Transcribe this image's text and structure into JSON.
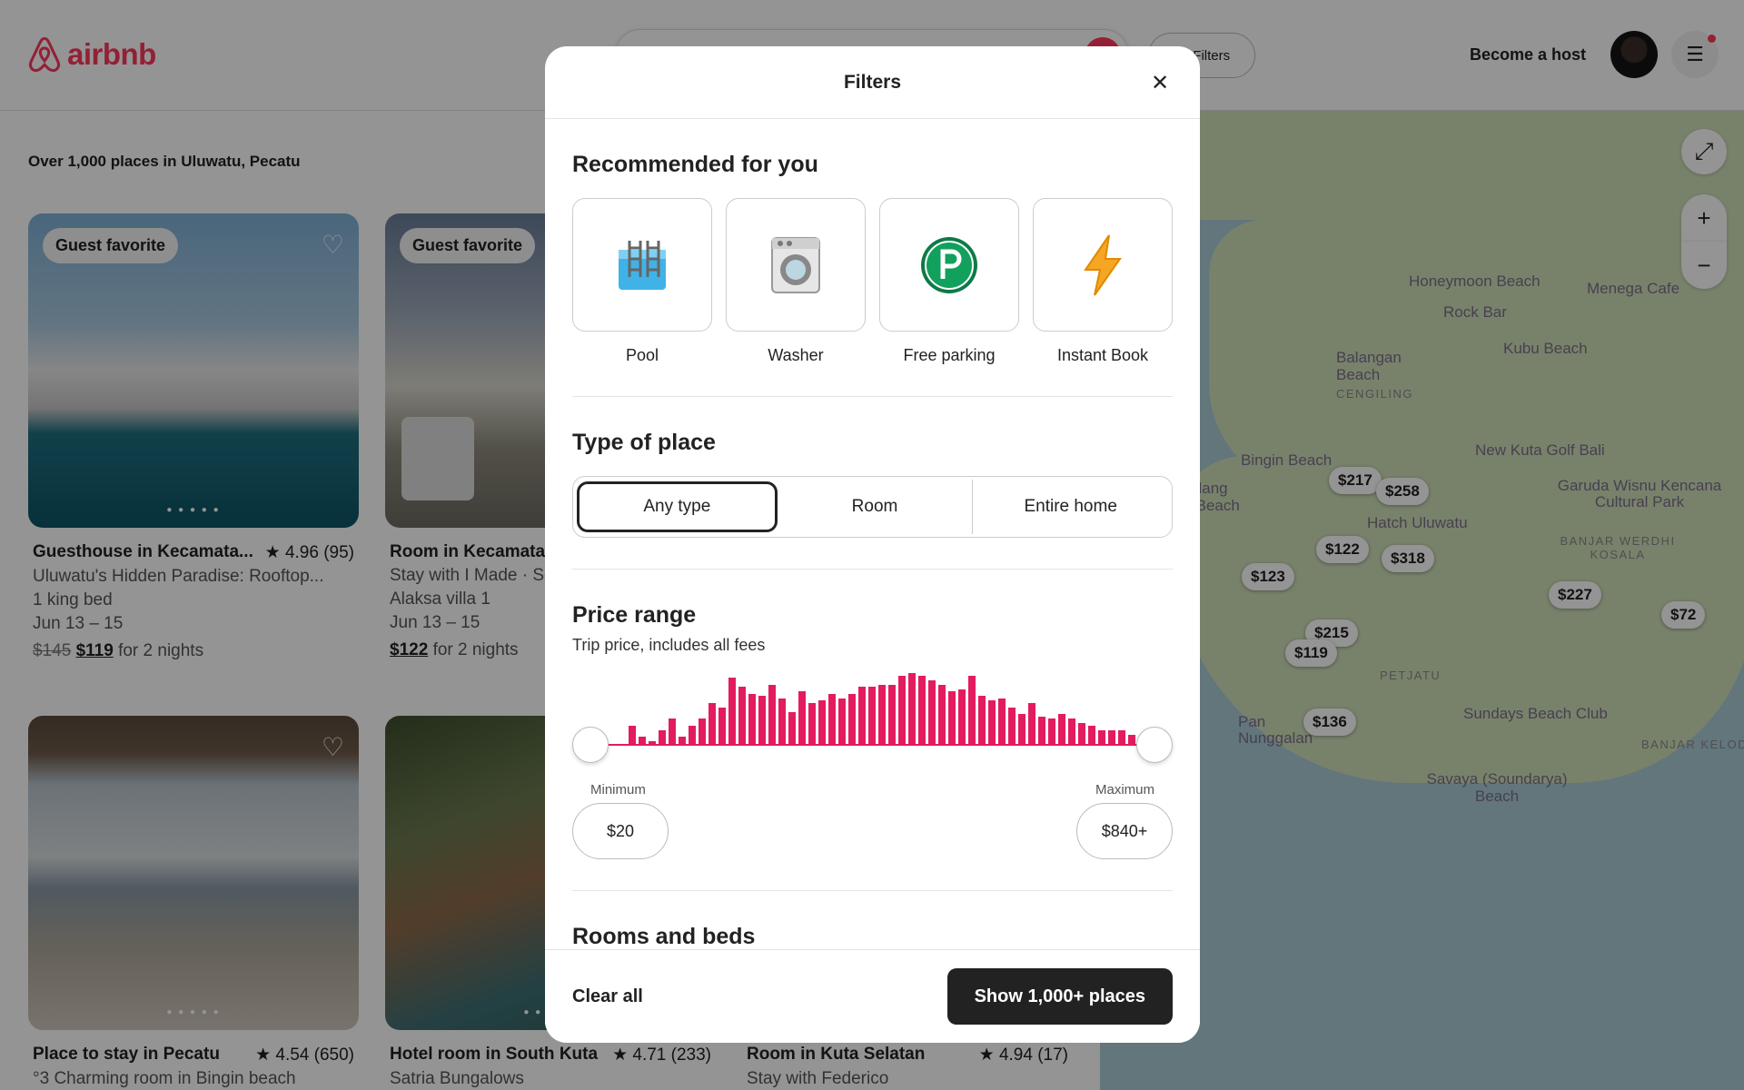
{
  "header": {
    "logo_text": "airbnb",
    "filters_label": "Filters",
    "become_host": "Become a host"
  },
  "results_count": "Over 1,000 places in Uluwatu, Pecatu",
  "listings": [
    {
      "badge": "Guest favorite",
      "title": "Guesthouse in Kecamata...",
      "rating": "★ 4.96 (95)",
      "line1": "Uluwatu's Hidden Paradise: Rooftop...",
      "line2": "1 king bed",
      "dates": "Jun 13 – 15",
      "old_price": "$145",
      "price": "$119",
      "price_suffix": "for 2 nights"
    },
    {
      "badge": "Guest favorite",
      "title": "Room in Kecamatan",
      "rating": "",
      "line1": "Stay with I Made · Se",
      "line2": "Alaksa villa 1",
      "dates": "Jun 13 – 15",
      "old_price": "",
      "price": "$122",
      "price_suffix": "for 2 nights"
    },
    {
      "badge": "",
      "title": "Place to stay in Pecatu",
      "rating": "★ 4.54 (650)",
      "line1": "°3 Charming room in Bingin beach"
    },
    {
      "badge": "",
      "title": "Hotel room in South Kuta",
      "rating": "★ 4.71 (233)",
      "line1": "Satria Bungalows"
    },
    {
      "badge": "",
      "title": "Room in Kuta Selatan",
      "rating": "★ 4.94 (17)",
      "line1": "Stay with Federico"
    }
  ],
  "map": {
    "labels": [
      "Honeymoon Beach",
      "Menega Cafe",
      "Rock Bar",
      "Kubu Beach",
      "Balangan Beach",
      "Bingin Beach",
      "New Kuta Golf Bali",
      "Padang ng Beach",
      "Hatch Uluwatu",
      "Garuda Wisnu Kencana Cultural Park",
      "Sundays Beach Club",
      "Pan Nunggalan",
      "Savaya (Soundarya) Beach"
    ],
    "grey_labels": [
      "CENGILING",
      "BANJAR WERDHI KOSALA",
      "PETJATU",
      "BANJAR KELOD"
    ],
    "prices": [
      "$217",
      "$258",
      "$122",
      "$318",
      "$123",
      "$227",
      "$72",
      "$215",
      "$119",
      "$136"
    ]
  },
  "filters": {
    "title": "Filters",
    "recommended": {
      "heading": "Recommended for you",
      "items": [
        {
          "label": "Pool",
          "icon": "pool-icon"
        },
        {
          "label": "Washer",
          "icon": "washer-icon"
        },
        {
          "label": "Free parking",
          "icon": "parking-icon"
        },
        {
          "label": "Instant Book",
          "icon": "lightning-icon"
        }
      ]
    },
    "type_of_place": {
      "heading": "Type of place",
      "options": [
        "Any type",
        "Room",
        "Entire home"
      ],
      "selected": "Any type"
    },
    "price_range": {
      "heading": "Price range",
      "subtext": "Trip price, includes all fees",
      "histogram": [
        0,
        0,
        18,
        8,
        4,
        14,
        24,
        8,
        18,
        24,
        38,
        34,
        60,
        52,
        46,
        44,
        54,
        42,
        30,
        48,
        38,
        40,
        46,
        42,
        46,
        52,
        52,
        54,
        54,
        62,
        64,
        62,
        58,
        54,
        48,
        50,
        62,
        44,
        40,
        42,
        34,
        28,
        38,
        26,
        24,
        28,
        24,
        20,
        18,
        14,
        14,
        14,
        10
      ],
      "min_label": "Minimum",
      "max_label": "Maximum",
      "min_value": "$20",
      "max_value": "$840+"
    },
    "rooms_heading": "Rooms and beds",
    "clear_all": "Clear all",
    "show_button": "Show 1,000+ places"
  },
  "colors": {
    "brand": "#ff385c",
    "histogram": "#e31c5f",
    "dark": "#222222"
  }
}
